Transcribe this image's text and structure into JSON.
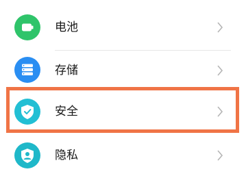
{
  "settings": {
    "items": [
      {
        "label": "电池",
        "icon": "battery-icon",
        "color": "#2fc46a"
      },
      {
        "label": "存储",
        "icon": "storage-icon",
        "color": "#2a8ef2"
      },
      {
        "label": "安全",
        "icon": "shield-icon",
        "color": "#22bfd4"
      },
      {
        "label": "隐私",
        "icon": "privacy-icon",
        "color": "#1fb8c9"
      }
    ]
  },
  "highlight_color": "#f07446"
}
